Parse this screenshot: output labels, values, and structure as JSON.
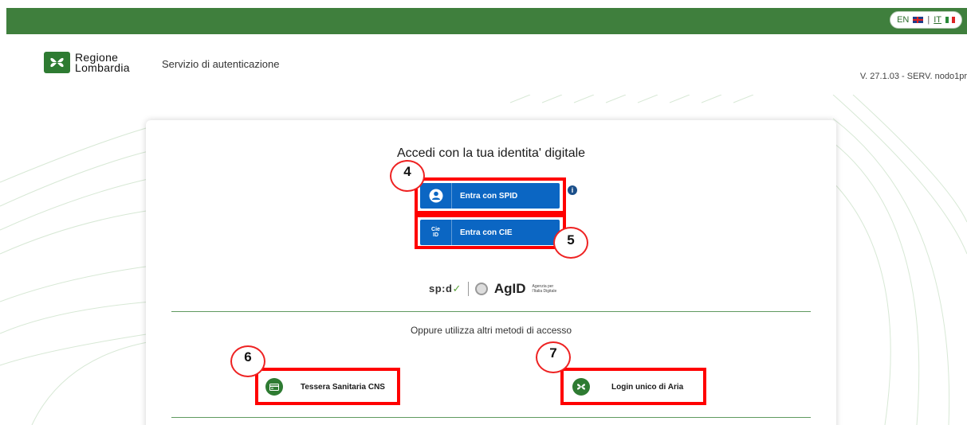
{
  "topbar": {
    "languages": [
      {
        "code": "EN",
        "flag": "flag-uk-icon"
      },
      {
        "code": "IT",
        "flag": "flag-it-icon"
      }
    ],
    "separator": "|"
  },
  "header": {
    "logo_line1": "Regione",
    "logo_line2": "Lombardia",
    "service_title": "Servizio di autenticazione",
    "version": "V. 27.1.03 - SERV. nodo1pr"
  },
  "card": {
    "title": "Accedi con la tua identita' digitale",
    "spid_button": "Entra con SPID",
    "cie_button": "Entra con CIE",
    "cie_icon_text": "Cie ID",
    "info_icon": "i",
    "spid_logo": "sp:d",
    "agid_logo": "AgID",
    "agid_subtitle": "Agenzia per l'Italia Digitale",
    "alt_title": "Oppure utilizza altri metodi di accesso",
    "cns_button": "Tessera Sanitaria CNS",
    "aria_button": "Login unico di Aria"
  },
  "annotations": {
    "badge_spid": "4",
    "badge_cie": "5",
    "badge_cns": "6",
    "badge_aria": "7"
  },
  "colors": {
    "topbar": "#3f7f3d",
    "primary_button": "#0b66c3",
    "highlight": "#ff0000",
    "brand_green": "#2e7b32"
  }
}
